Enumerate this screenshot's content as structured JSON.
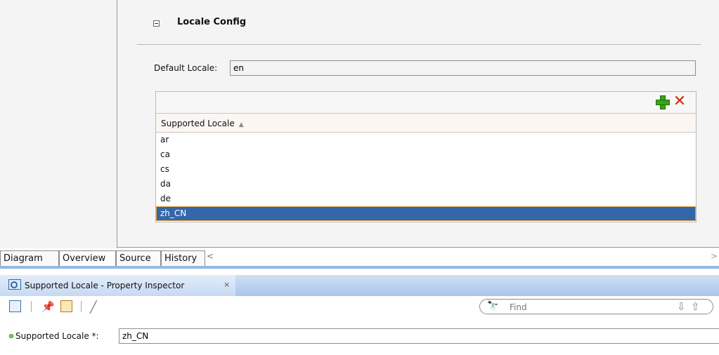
{
  "section": {
    "title": "Locale Config"
  },
  "default_locale": {
    "label": "Default Locale:",
    "value": "en"
  },
  "locale_table": {
    "column_header": "Supported Locale",
    "rows": [
      "ar",
      "ca",
      "cs",
      "da",
      "de",
      "zh_CN"
    ],
    "selected_row": "zh_CN"
  },
  "editor_tabs": [
    "Diagram",
    "Overview",
    "Source",
    "History"
  ],
  "inspector": {
    "title": "Supported Locale - Property Inspector",
    "close": "×",
    "find_placeholder": "Find",
    "property_label": "Supported Locale *:",
    "property_value": "zh_CN"
  },
  "icons": {
    "add": "green-plus-icon",
    "delete": "red-x-icon",
    "sort": "sort-ascending-icon",
    "find": "binoculars-icon"
  }
}
